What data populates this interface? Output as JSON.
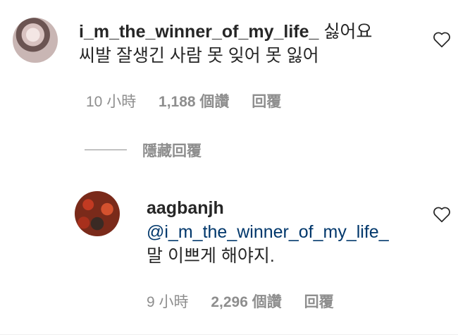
{
  "comments": [
    {
      "username": "i_m_the_winner_of_my_life_",
      "text_line1": "싫어요",
      "text_line2": "씨발 잘생긴 사람 못 잊어 못 잃어",
      "time": "10 小時",
      "likes": "1,188 個讚",
      "reply": "回覆",
      "avatar": "avatar-woman"
    },
    {
      "username": "aagbanjh",
      "mention": "@i_m_the_winner_of_my_life_",
      "text": "말 이쁘게 해야지.",
      "time": "9 小時",
      "likes": "2,296 個讚",
      "reply": "回覆",
      "avatar": "avatar-red-leaves"
    }
  ],
  "hide_replies": "隱藏回覆",
  "icons": {
    "like": "heart-icon"
  }
}
